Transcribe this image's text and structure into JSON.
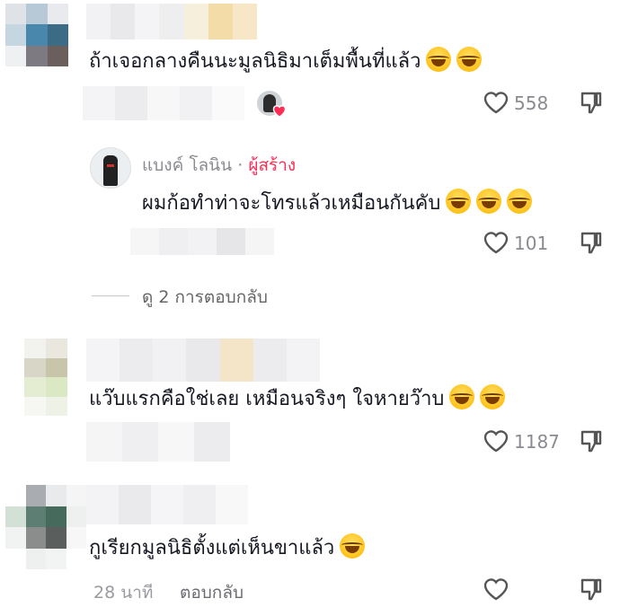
{
  "comments": [
    {
      "text": "ถ้าเจอกลางคืนนะมูลนิธิมาเต็มพื้นที่แล้ว",
      "emoji": [
        "face-with-tears-of-joy",
        "face-with-tears-of-joy"
      ],
      "likes": "558"
    },
    {
      "author": "แบงค์ โลนิน",
      "author_sep": "·",
      "author_badge": "ผู้สร้าง",
      "text": "ผมก้อทำท่าจะโทรแล้วเหมือนกันคับ",
      "emoji": [
        "face-with-tears-of-joy",
        "face-with-tears-of-joy",
        "face-with-tears-of-joy"
      ],
      "likes": "101"
    },
    {
      "text": "แว๊บแรกคือใช่เลย เหมือนจริงๆ ใจหายว๊าบ",
      "emoji": [
        "rolling-on-floor-laughing",
        "rolling-on-floor-laughing"
      ],
      "likes": "1187"
    },
    {
      "text": "กูเรียกมูลนิธิตั้งแต่เห็นขาแล้ว",
      "emoji": [
        "rolling-on-floor-laughing"
      ],
      "time": "28 นาที",
      "reply_label": "ตอบกลับ"
    }
  ],
  "view_replies": "ดู 2 การตอบกลับ",
  "colors": {
    "text": "#161823",
    "muted": "#8a8b91",
    "creator_badge": "#fe2c55",
    "emoji": "#ffc21a"
  },
  "icons": {
    "like": "heart-outline-icon",
    "dislike": "thumbs-down-icon",
    "creator_liked": "heart-filled-icon"
  }
}
